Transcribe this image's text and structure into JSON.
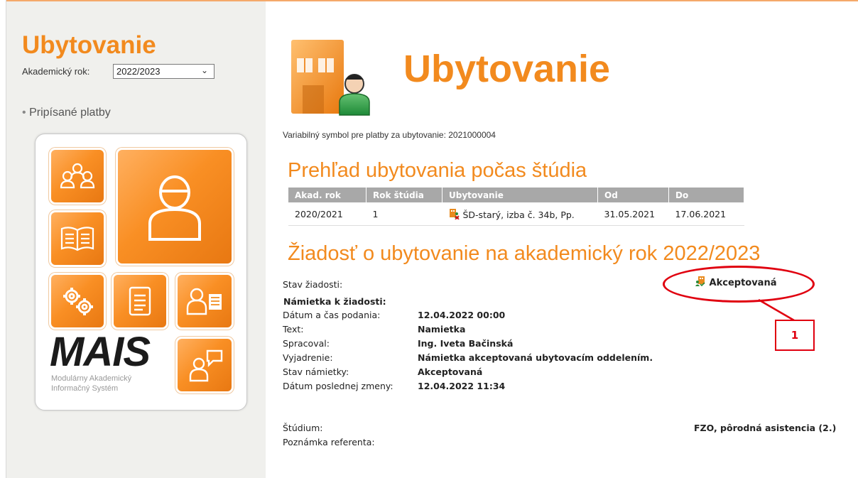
{
  "sidebar": {
    "title": "Ubytovanie",
    "year_label": "Akademický rok:",
    "year_value": "2022/2023",
    "link": "Pripísané platby",
    "mais_logo": "MAIS",
    "mais_subtitle_line1": "Modulárny Akademický",
    "mais_subtitle_line2": "Informačný Systém"
  },
  "main": {
    "title": "Ubytovanie",
    "var_symbol": "Variabilný symbol pre platby za ubytovanie: 2021000004",
    "overview_title": "Prehľad ubytovania počas štúdia",
    "table": {
      "headers": [
        "Akad. rok",
        "Rok štúdia",
        "Ubytovanie",
        "Od",
        "Do"
      ],
      "rows": [
        [
          "2020/2021",
          "1",
          "ŠD-starý, izba č. 34b, Pp.",
          "31.05.2021",
          "17.06.2021"
        ]
      ]
    },
    "request_title": "Žiadosť o ubytovanie na akademický rok 2022/2023",
    "request": {
      "status_label": "Stav žiadosti:",
      "status_value": "Akceptovaná",
      "objection_header": "Námietka k žiadosti:",
      "fields": [
        {
          "label": "Dátum a čas podania:",
          "value": "12.04.2022 00:00"
        },
        {
          "label": "Text:",
          "value": "Namietka"
        },
        {
          "label": "Spracoval:",
          "value": "Ing. Iveta Bačinská"
        },
        {
          "label": "Vyjadrenie:",
          "value": "Námietka akceptovaná ubytovacím oddelením."
        },
        {
          "label": "Stav námietky:",
          "value": "Akceptovaná"
        },
        {
          "label": "Dátum poslednej zmeny:",
          "value": "12.04.2022 11:34"
        }
      ],
      "study_label": "Štúdium:",
      "study_value": "FZO, pôrodná asistencia (2.)",
      "note_label": "Poznámka referenta:"
    }
  },
  "annotation": {
    "callout_number": "1"
  },
  "colors": {
    "accent": "#f28a1e",
    "annotation": "#e0000f",
    "sidebar_bg": "#f0f0ed",
    "table_header": "#a8a8a8"
  }
}
